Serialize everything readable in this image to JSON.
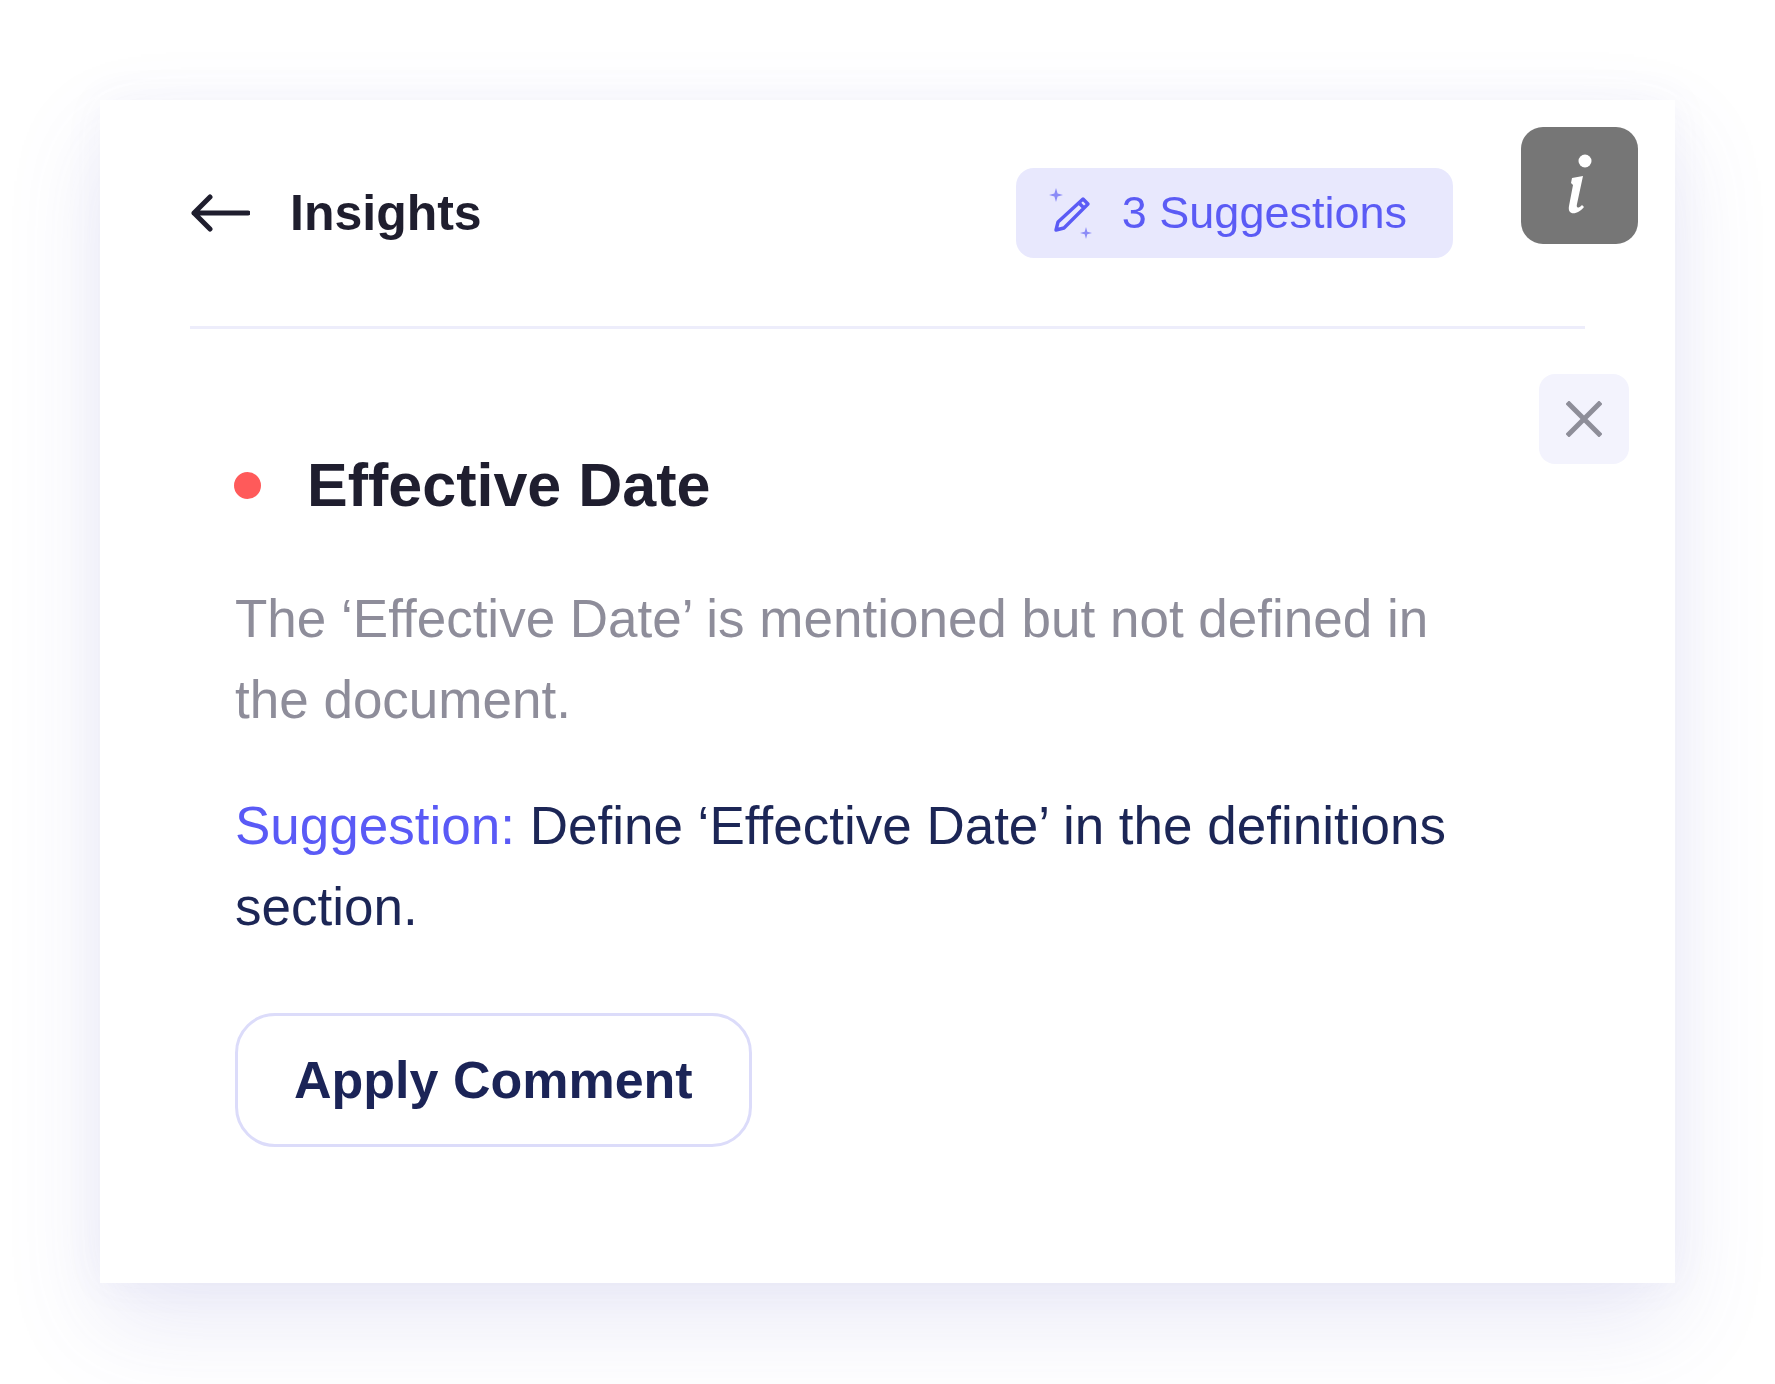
{
  "header": {
    "title": "Insights",
    "suggestions": "3 Suggestions"
  },
  "insights": [
    {
      "color": "#ff5a5a",
      "title": "Effective Date",
      "description": "The ‘Effective Date’ is mentioned but not defined in the document.",
      "suggestion": {
        "label": "Suggestion:",
        "text": "Define ‘Effective Date’ in the definitions section."
      },
      "action": "Apply Comment"
    }
  ]
}
